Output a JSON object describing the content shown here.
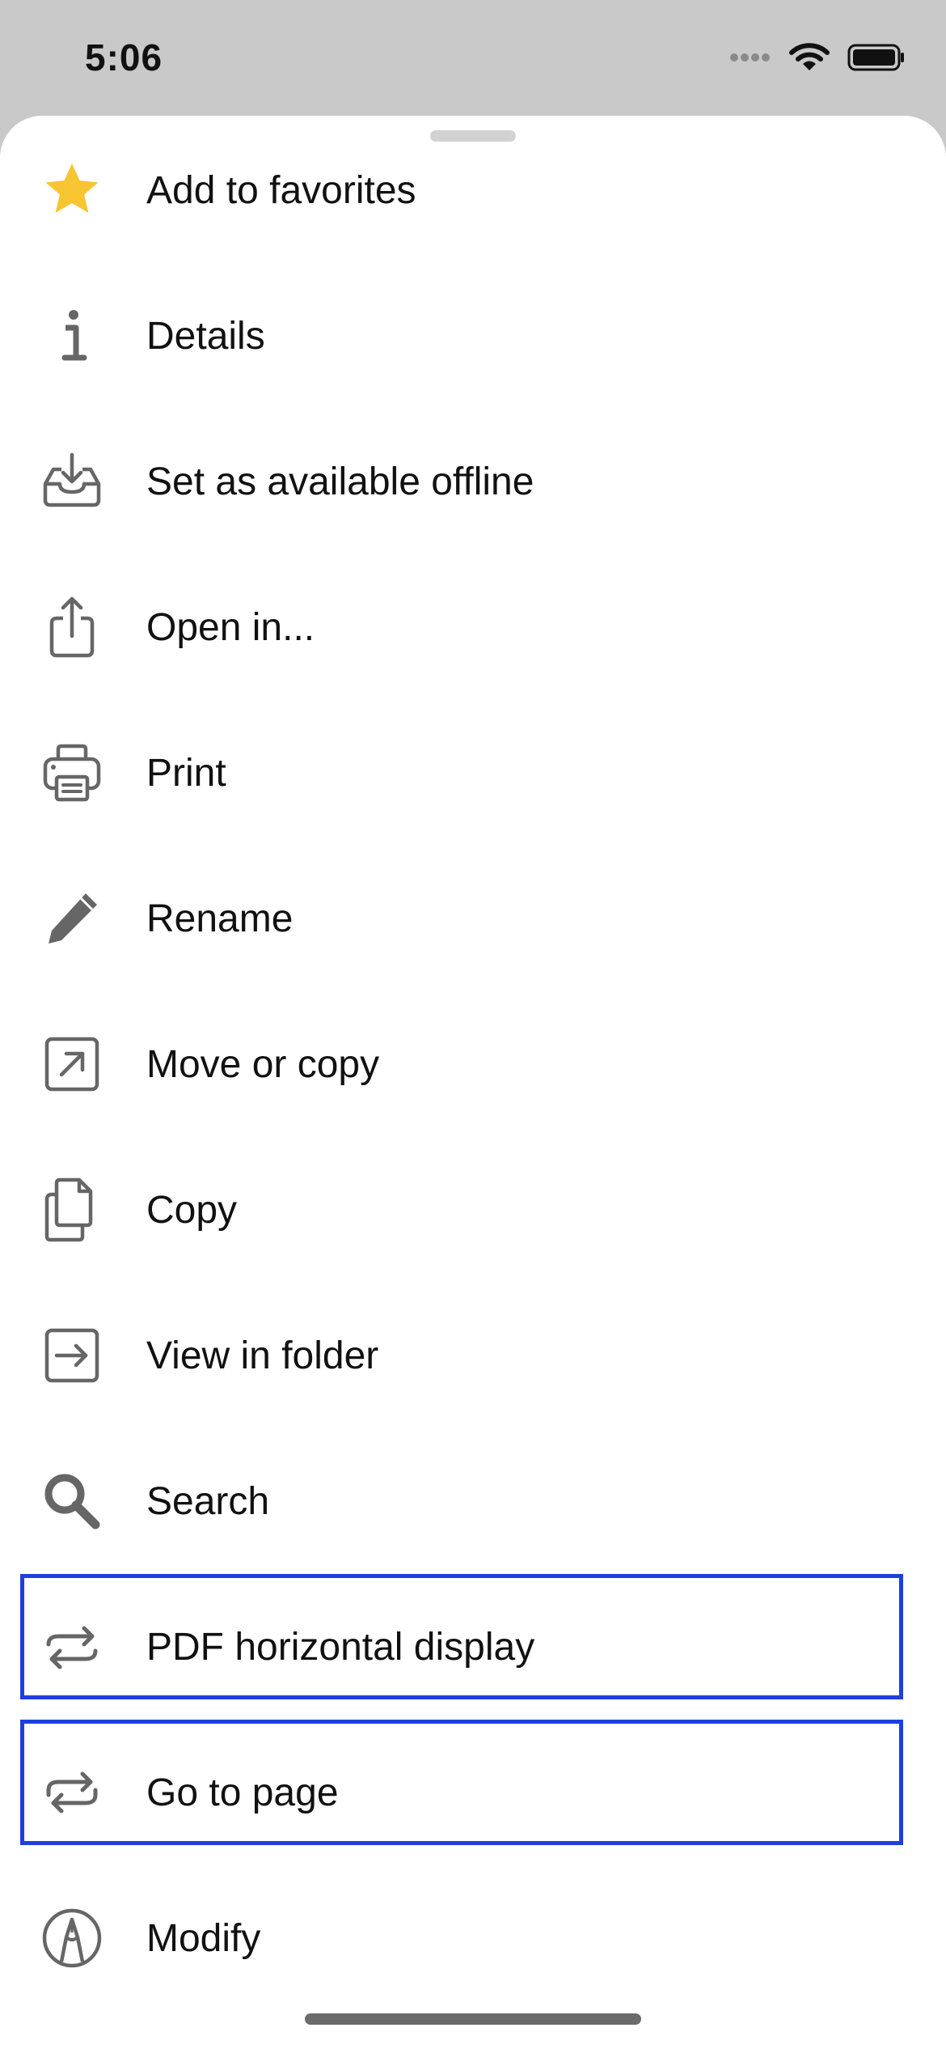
{
  "status_bar": {
    "time": "5:06",
    "icons": [
      "signal-dots-icon",
      "wifi-icon",
      "battery-icon"
    ]
  },
  "sheet": {
    "items": [
      {
        "label": "Add to favorites",
        "icon": "star-icon"
      },
      {
        "label": "Details",
        "icon": "info-icon"
      },
      {
        "label": "Set as available offline",
        "icon": "offline-download-icon"
      },
      {
        "label": "Open in...",
        "icon": "share-icon"
      },
      {
        "label": "Print",
        "icon": "printer-icon"
      },
      {
        "label": "Rename",
        "icon": "pencil-icon"
      },
      {
        "label": "Move or copy",
        "icon": "move-arrow-icon"
      },
      {
        "label": "Copy",
        "icon": "copy-icon"
      },
      {
        "label": "View in folder",
        "icon": "view-in-folder-icon"
      },
      {
        "label": "Search",
        "icon": "search-icon"
      },
      {
        "label": "PDF horizontal display",
        "icon": "horizontal-arrows-icon"
      },
      {
        "label": "Go to page",
        "icon": "go-to-page-arrows-icon"
      },
      {
        "label": "Modify",
        "icon": "pen-nib-circle-icon"
      }
    ]
  },
  "colors": {
    "highlight": "#1d3fe0",
    "star": "#f7c531",
    "icon": "#666666"
  }
}
